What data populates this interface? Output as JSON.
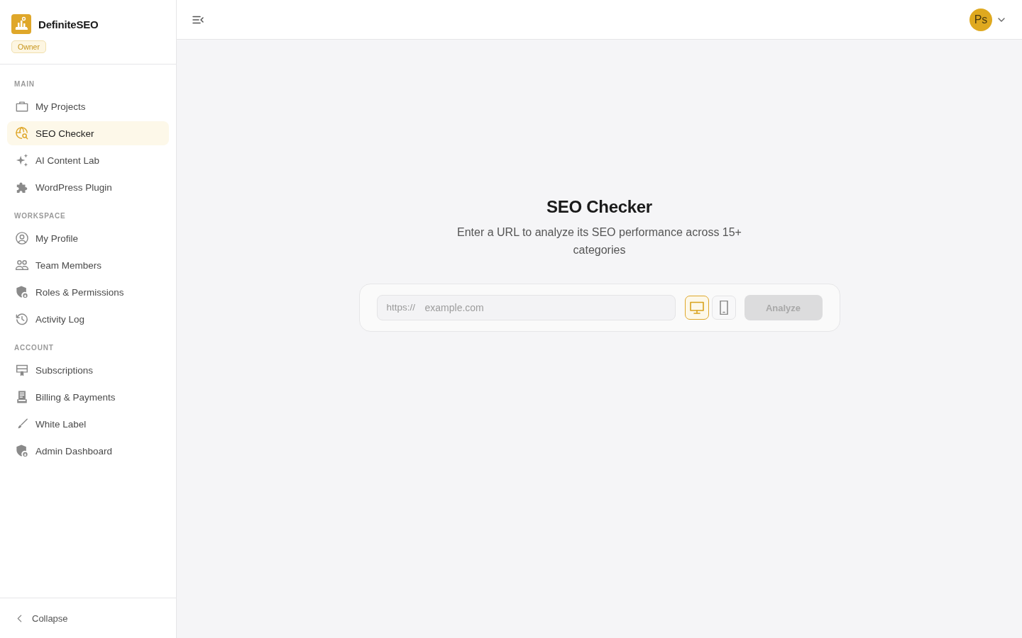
{
  "brand": {
    "name": "DefiniteSEO",
    "role_badge": "Owner"
  },
  "sidebar": {
    "sections": [
      {
        "heading": "MAIN",
        "items": [
          {
            "label": "My Projects",
            "selected": false
          },
          {
            "label": "SEO Checker",
            "selected": true
          },
          {
            "label": "AI Content Lab",
            "selected": false
          },
          {
            "label": "WordPress Plugin",
            "selected": false
          }
        ]
      },
      {
        "heading": "WORKSPACE",
        "items": [
          {
            "label": "My Profile",
            "selected": false
          },
          {
            "label": "Team Members",
            "selected": false
          },
          {
            "label": "Roles & Permissions",
            "selected": false
          },
          {
            "label": "Activity Log",
            "selected": false
          }
        ]
      },
      {
        "heading": "ACCOUNT",
        "items": [
          {
            "label": "Subscriptions",
            "selected": false
          },
          {
            "label": "Billing & Payments",
            "selected": false
          },
          {
            "label": "White Label",
            "selected": false
          },
          {
            "label": "Admin Dashboard",
            "selected": false
          }
        ]
      }
    ],
    "collapse_label": "Collapse"
  },
  "topbar": {
    "avatar_initials": "Ps"
  },
  "checker": {
    "title": "SEO Checker",
    "subtitle": "Enter a URL to analyze its SEO performance across 15+ categories",
    "url_prefix": "https://",
    "url_placeholder": "example.com",
    "devices": [
      {
        "kind": "desktop",
        "selected": true
      },
      {
        "kind": "mobile",
        "selected": false
      }
    ],
    "analyze_button": {
      "label": "Analyze",
      "disabled": true
    }
  }
}
